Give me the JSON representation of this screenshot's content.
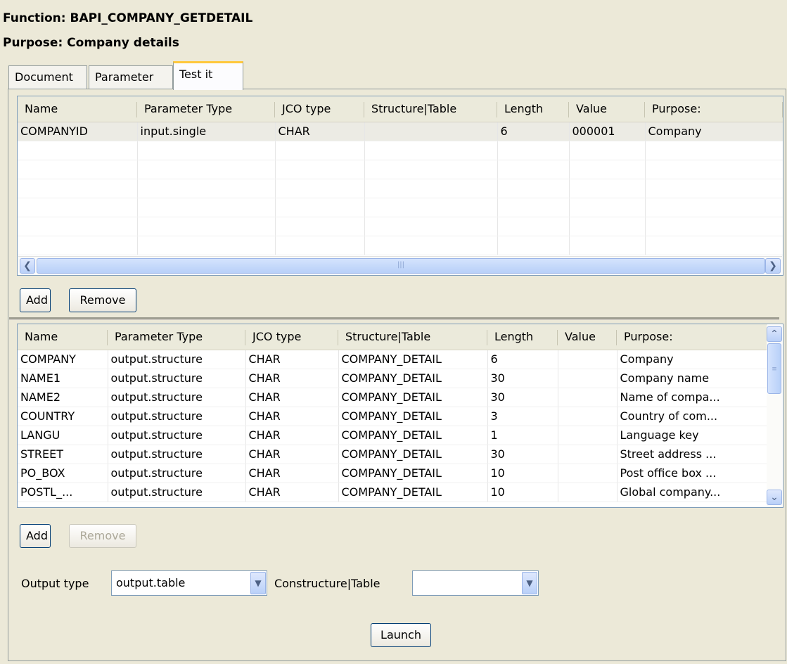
{
  "header": {
    "function_line": "Function: BAPI_COMPANY_GETDETAIL",
    "purpose_line": "Purpose:  Company details"
  },
  "tabs": [
    {
      "label": "Document",
      "active": false
    },
    {
      "label": "Parameter",
      "active": false
    },
    {
      "label": "Test it",
      "active": true
    }
  ],
  "input_table": {
    "columns": [
      "Name",
      "Parameter Type",
      "JCO type",
      "Structure|Table",
      "Length",
      "Value",
      "Purpose:"
    ],
    "rows": [
      [
        "COMPANYID",
        "input.single",
        "CHAR",
        "",
        "6",
        "000001",
        "Company"
      ]
    ]
  },
  "input_buttons": {
    "add": "Add",
    "remove": "Remove"
  },
  "output_table": {
    "columns": [
      "Name",
      "Parameter Type",
      "JCO type",
      "Structure|Table",
      "Length",
      "Value",
      "Purpose:"
    ],
    "rows": [
      [
        "COMPANY",
        "output.structure",
        "CHAR",
        "COMPANY_DETAIL",
        "6",
        "",
        "Company"
      ],
      [
        "NAME1",
        "output.structure",
        "CHAR",
        "COMPANY_DETAIL",
        "30",
        "",
        "Company name"
      ],
      [
        "NAME2",
        "output.structure",
        "CHAR",
        "COMPANY_DETAIL",
        "30",
        "",
        "Name of compa..."
      ],
      [
        "COUNTRY",
        "output.structure",
        "CHAR",
        "COMPANY_DETAIL",
        "3",
        "",
        "Country of com..."
      ],
      [
        "LANGU",
        "output.structure",
        "CHAR",
        "COMPANY_DETAIL",
        "1",
        "",
        "Language key"
      ],
      [
        "STREET",
        "output.structure",
        "CHAR",
        "COMPANY_DETAIL",
        "30",
        "",
        "Street address ..."
      ],
      [
        "PO_BOX",
        "output.structure",
        "CHAR",
        "COMPANY_DETAIL",
        "10",
        "",
        "Post office box ..."
      ],
      [
        "POSTL_...",
        "output.structure",
        "CHAR",
        "COMPANY_DETAIL",
        "10",
        "",
        "Global company..."
      ]
    ]
  },
  "output_buttons": {
    "add": "Add",
    "remove": "Remove"
  },
  "bottom": {
    "output_type_label": "Output type",
    "output_type_value": "output.table",
    "constructure_label": "Constructure|Table",
    "constructure_value": "",
    "launch_label": "Launch"
  },
  "scroll_icons": {
    "left": "left-arrow-icon",
    "right": "right-arrow-icon",
    "up": "up-arrow-icon",
    "down": "down-arrow-icon",
    "dropdown": "chevron-down-icon"
  }
}
